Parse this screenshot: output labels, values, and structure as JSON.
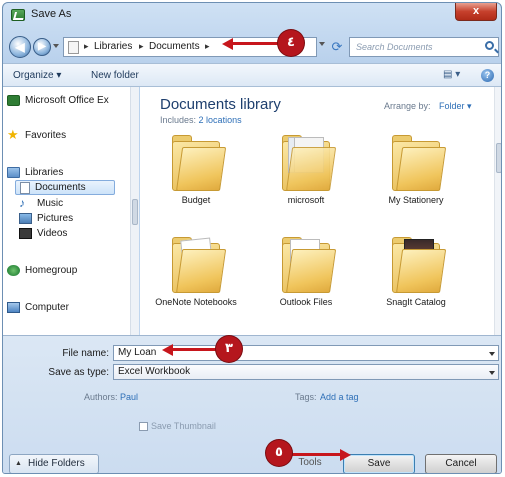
{
  "window": {
    "title": "Save As",
    "close_label": "x"
  },
  "address": {
    "crumbs": [
      "Libraries",
      "Documents"
    ],
    "search_placeholder": "Search Documents"
  },
  "commandbar": {
    "organize": "Organize ▾",
    "new_folder": "New folder",
    "help": "?"
  },
  "nav": {
    "items": [
      {
        "label": "Microsoft Office Ex",
        "icon": "office-icon"
      },
      {
        "label": "Favorites",
        "icon": "star-icon"
      },
      {
        "label": "Libraries",
        "icon": "libraries-icon"
      },
      {
        "label": "Documents",
        "icon": "document-icon"
      },
      {
        "label": "Music",
        "icon": "music-icon"
      },
      {
        "label": "Pictures",
        "icon": "pictures-icon"
      },
      {
        "label": "Videos",
        "icon": "videos-icon"
      },
      {
        "label": "Homegroup",
        "icon": "homegroup-icon"
      },
      {
        "label": "Computer",
        "icon": "computer-icon"
      }
    ]
  },
  "library": {
    "title": "Documents library",
    "includes_label": "Includes:",
    "includes_link": "2 locations",
    "arrange_label": "Arrange by:",
    "arrange_value": "Folder ▾"
  },
  "folders": [
    {
      "label": "Budget"
    },
    {
      "label": "microsoft"
    },
    {
      "label": "My Stationery"
    },
    {
      "label": "OneNote Notebooks"
    },
    {
      "label": "Outlook Files"
    },
    {
      "label": "SnagIt Catalog"
    }
  ],
  "fields": {
    "filename_label": "File name:",
    "filename_value": "My Loan",
    "savetype_label": "Save as type:",
    "savetype_value": "Excel Workbook",
    "authors_label": "Authors:",
    "authors_value": "Paul",
    "tags_label": "Tags:",
    "tags_value": "Add a tag",
    "thumbnail_label": "Save Thumbnail"
  },
  "buttons": {
    "hide_folders": "Hide Folders",
    "tools": "Tools",
    "save": "Save",
    "cancel": "Cancel"
  },
  "callouts": {
    "step3": "٣",
    "step4": "٤",
    "step5": "٥"
  },
  "colors": {
    "callout": "#c7161c",
    "link": "#2e6fb7",
    "title": "#1e3f6e"
  }
}
